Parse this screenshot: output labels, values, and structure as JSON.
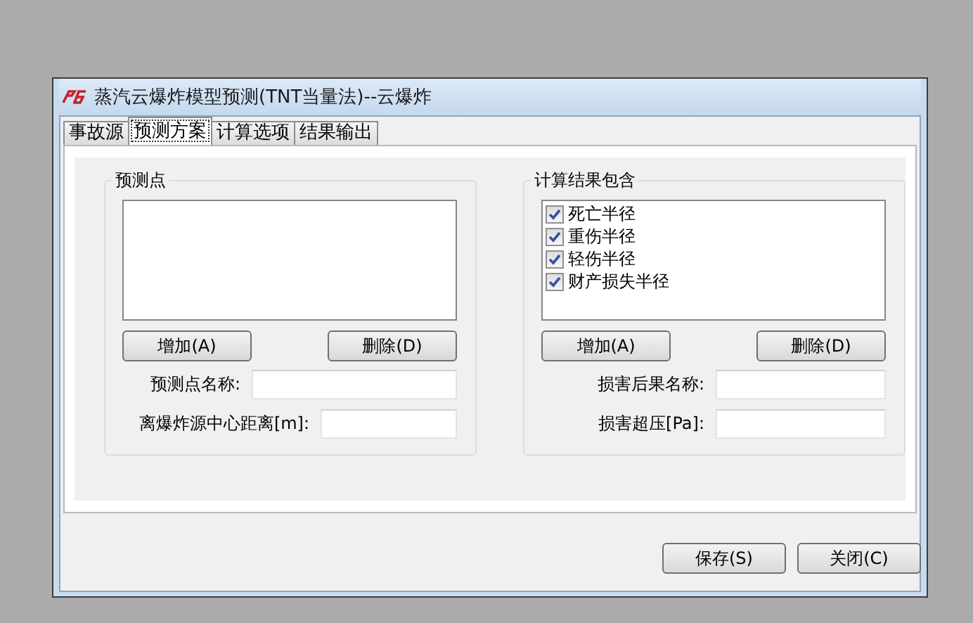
{
  "window": {
    "title": "蒸汽云爆炸模型预测(TNT当量法)--云爆炸"
  },
  "tabs": [
    {
      "label": "事故源",
      "selected": false
    },
    {
      "label": "预测方案",
      "selected": true
    },
    {
      "label": "计算选项",
      "selected": false
    },
    {
      "label": "结果输出",
      "selected": false
    }
  ],
  "prediction_points": {
    "title": "预测点",
    "buttons": [
      "增加(A)",
      "删除(D)"
    ],
    "fields": [
      {
        "label": "预测点名称:"
      },
      {
        "label": "离爆炸源中心距离[m]:"
      }
    ]
  },
  "results_included": {
    "title": "计算结果包含",
    "items": [
      {
        "label": "死亡半径",
        "checked": true
      },
      {
        "label": "重伤半径",
        "checked": true
      },
      {
        "label": "轻伤半径",
        "checked": true
      },
      {
        "label": "财产损失半径",
        "checked": true
      }
    ],
    "buttons": [
      "增加(A)",
      "删除(D)"
    ],
    "fields": [
      {
        "label": "损害后果名称:"
      },
      {
        "label": "损害超压[Pa]:"
      }
    ]
  },
  "buttons": [
    "保存(S)",
    "关闭(C)"
  ]
}
